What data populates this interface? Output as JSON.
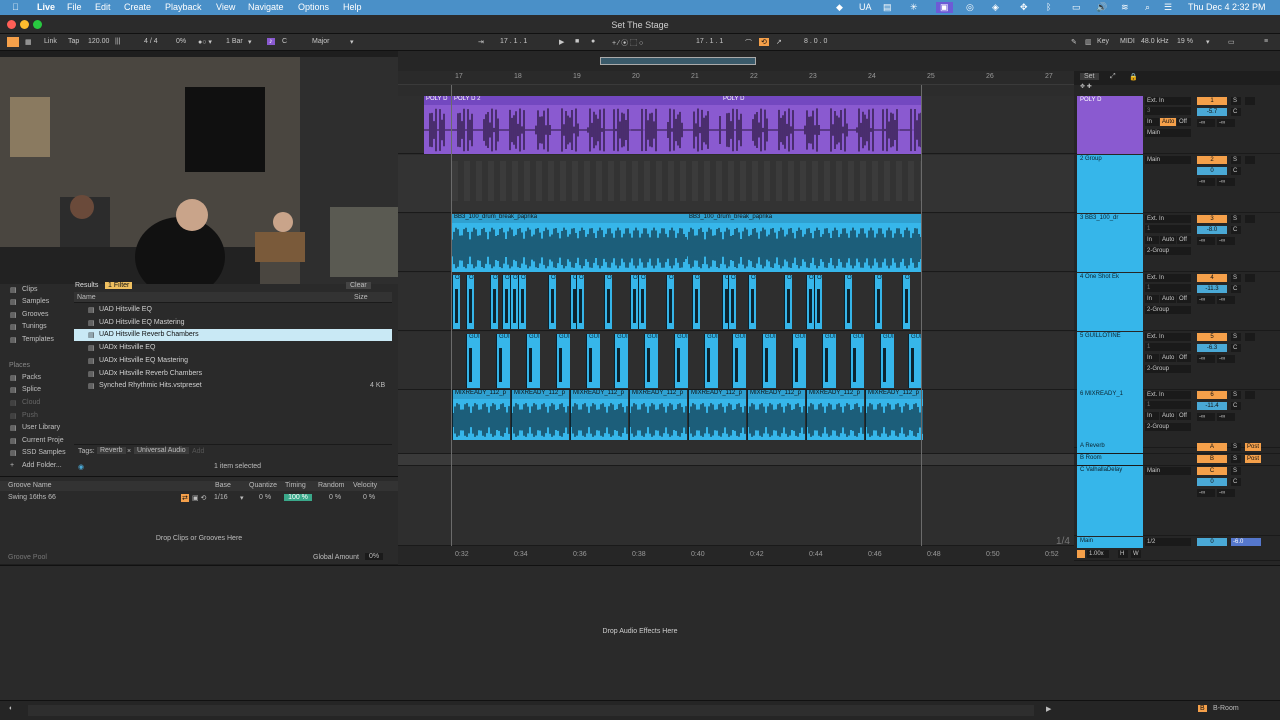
{
  "menubar": {
    "app_name": "Live",
    "items": [
      "File",
      "Edit",
      "Create",
      "Playback",
      "View",
      "Navigate",
      "Options",
      "Help"
    ],
    "status_ua": "UA",
    "clock": "Thu Dec 4  2:32 PM"
  },
  "window": {
    "title": "Set The Stage"
  },
  "control_bar": {
    "link": "Link",
    "tap": "Tap",
    "tempo": "120.00",
    "time_sig": "4 / 4",
    "nudge": "0%",
    "quantize": "1 Bar",
    "key": "C",
    "scale": "Major",
    "position": "17 .  1 .  1",
    "loop_start": "17 .  1 .  1",
    "loop_length": "8 .  0 .  0",
    "key_btn": "Key",
    "midi_btn": "MIDI",
    "sample_rate": "48.0 kHz",
    "cpu": "19 %"
  },
  "ruler": {
    "bars": [
      "17",
      "18",
      "19",
      "20",
      "21",
      "22",
      "23",
      "24",
      "25",
      "26",
      "27"
    ],
    "times": [
      "0:32",
      "0:34",
      "0:36",
      "0:38",
      "0:40",
      "0:42",
      "0:44",
      "0:46",
      "0:48",
      "0:50",
      "0:52"
    ],
    "zoom_label": "1/4"
  },
  "browser": {
    "tab_results": "Results",
    "filter": "1 Filter",
    "clear": "Clear",
    "col_name": "Name",
    "col_size": "Size",
    "categories": [
      "Clips",
      "Samples",
      "Grooves",
      "Tunings",
      "Templates"
    ],
    "places_label": "Places",
    "places": [
      "Packs",
      "Splice",
      "Cloud",
      "Push",
      "User Library",
      "Current Proje",
      "SSD Samples",
      "Add Folder..."
    ],
    "files": [
      {
        "name": "UAD Hitsville EQ",
        "size": ""
      },
      {
        "name": "UAD Hitsville EQ Mastering",
        "size": ""
      },
      {
        "name": "UAD Hitsville Reverb Chambers",
        "size": ""
      },
      {
        "name": "UADx Hitsville EQ",
        "size": ""
      },
      {
        "name": "UADx Hitsville EQ Mastering",
        "size": ""
      },
      {
        "name": "UADx Hitsville Reverb Chambers",
        "size": ""
      },
      {
        "name": "Synched Rhythmic Hits.vstpreset",
        "size": "4 KB"
      }
    ],
    "selected_index": 2,
    "tags_label": "Tags:",
    "tags": [
      "Reverb",
      "Universal Audio"
    ],
    "tag_add": "Add",
    "selection_status": "1 item selected"
  },
  "groove": {
    "col_name": "Groove Name",
    "col_base": "Base",
    "col_quantize": "Quantize",
    "col_timing": "Timing",
    "col_random": "Random",
    "col_velocity": "Velocity",
    "name": "Swing 16ths 66",
    "base": "1/16",
    "quantize": "0 %",
    "timing": "100 %",
    "random": "0 %",
    "velocity": "0 %",
    "drop_hint": "Drop Clips or Grooves Here",
    "pool_label": "Groove Pool",
    "global_amount_label": "Global Amount",
    "global_amount": "0%"
  },
  "tracks": [
    {
      "name": "POLY D",
      "clips": [
        "POLY D",
        "POLY D 2",
        "POLY D"
      ],
      "color": "#8a5ad0",
      "input": "Ext. In",
      "in_ch": "3",
      "route": "Main",
      "num": "1",
      "vol": "-5.7",
      "mon": [
        "In",
        "Auto",
        "Off"
      ]
    },
    {
      "name": "2 Group",
      "clips": [],
      "color": "#36b6ea",
      "input": "Main",
      "num": "2",
      "vol": "0"
    },
    {
      "name": "3 BB3_100_dr",
      "clips": [
        "BB3_100_drum_break_paprika",
        "BB3_100_drum_break_paprika"
      ],
      "color": "#36b6ea",
      "input": "Ext. In",
      "in_ch": "1",
      "route": "2-Group",
      "num": "3",
      "vol": "-8.0",
      "mon": [
        "In",
        "Auto",
        "Off"
      ]
    },
    {
      "name": "4 One Shot Ek",
      "clips": [
        "O"
      ],
      "color": "#36b6ea",
      "input": "Ext. In",
      "in_ch": "1",
      "route": "2-Group",
      "num": "4",
      "vol": "-11.3",
      "mon": [
        "In",
        "Auto",
        "Off"
      ]
    },
    {
      "name": "5 GUILLOTINE",
      "clips": [
        "GUI"
      ],
      "color": "#36b6ea",
      "input": "Ext. In",
      "in_ch": "1",
      "route": "2-Group",
      "num": "5",
      "vol": "-6.3",
      "mon": [
        "In",
        "Auto",
        "Off"
      ]
    },
    {
      "name": "6 MIXREADY_1",
      "clips": [
        "MIXREADY_112_p"
      ],
      "color": "#36b6ea",
      "input": "Ext. In",
      "in_ch": "1",
      "route": "2-Group",
      "num": "6",
      "vol": "-11.4",
      "mon": [
        "In",
        "Auto",
        "Off"
      ]
    }
  ],
  "returns": [
    {
      "name": "A Reverb",
      "letter": "A",
      "post": "Post"
    },
    {
      "name": "B Room",
      "letter": "B",
      "post": "Post"
    },
    {
      "name": "C ValhallaDelay",
      "letter": "C",
      "route": "Main",
      "vol": "0"
    }
  ],
  "main": {
    "name": "Main",
    "route": "1/2",
    "vol": "0",
    "peak": "-6.0",
    "zoom": "1.00x",
    "h": "H",
    "w": "W"
  },
  "mixer_header": {
    "set": "Set",
    "s": "S",
    "c": "C",
    "neg_inf": "-∞"
  },
  "device_panel": {
    "drop_hint": "Drop Audio Effects Here"
  },
  "status": {
    "track_label": "B-Room",
    "track_letter": "B"
  },
  "colors": {
    "accent": "#f5a04a",
    "clip_purple": "#8a5ad0",
    "clip_blue": "#36b6ea",
    "menubar": "#4a90c8"
  }
}
